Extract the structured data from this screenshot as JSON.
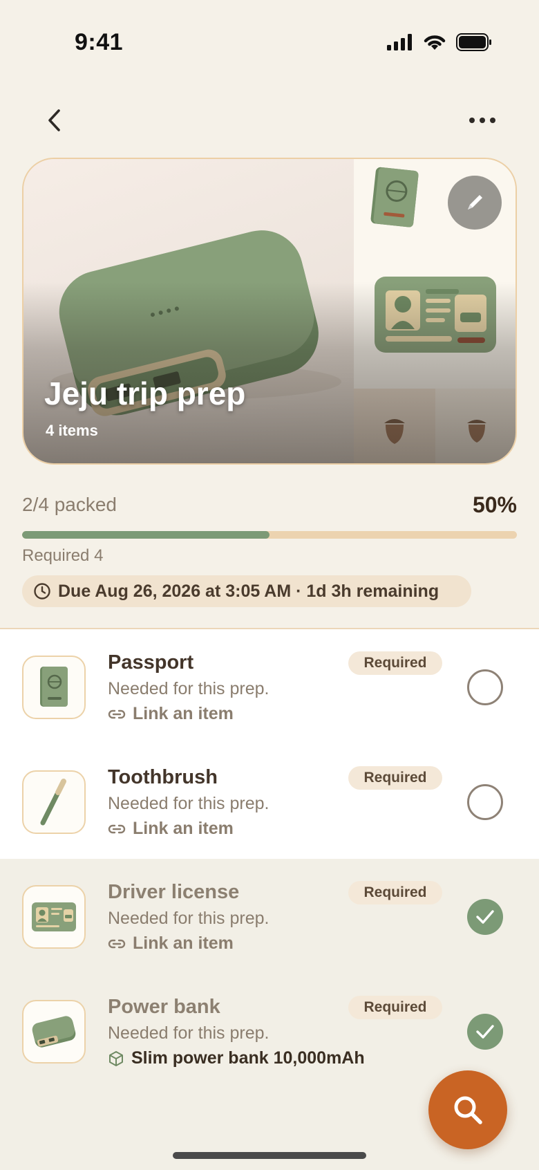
{
  "status_bar": {
    "time": "9:41"
  },
  "hero": {
    "title": "Jeju trip prep",
    "count": "4 items"
  },
  "progress": {
    "packed": "2/4 packed",
    "percent_label": "50%",
    "fraction": 0.5,
    "required": "Required 4",
    "due": "Due Aug 26, 2026 at 3:05 AM · 1d 3h remaining"
  },
  "items": [
    {
      "name": "Passport",
      "badge": "Required",
      "desc": "Needed for this prep.",
      "link": "Link an item",
      "checked": false,
      "icon": "passport-icon"
    },
    {
      "name": "Toothbrush",
      "badge": "Required",
      "desc": "Needed for this prep.",
      "link": "Link an item",
      "checked": false,
      "icon": "toothbrush-icon"
    },
    {
      "name": "Driver license",
      "badge": "Required",
      "desc": "Needed for this prep.",
      "link": "Link an item",
      "checked": true,
      "icon": "driver-license-icon"
    },
    {
      "name": "Power bank",
      "badge": "Required",
      "desc": "Needed for this prep.",
      "link": "Slim power bank 10,000mAh",
      "checked": true,
      "icon": "power-bank-icon"
    }
  ],
  "colors": {
    "accent": "#c96424",
    "green": "#7c9a76",
    "track": "#ecd3b0"
  },
  "icons": {
    "back": "chevron-left-icon",
    "more": "more-icon",
    "edit": "pencil-icon",
    "clock": "clock-icon",
    "fab": "search-icon"
  }
}
